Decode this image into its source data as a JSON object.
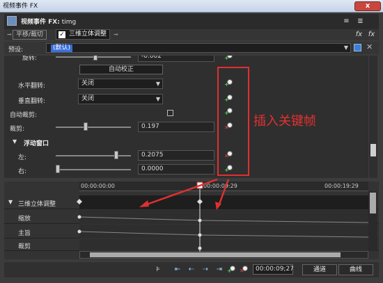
{
  "window": {
    "title": "视频事件 FX",
    "close_label": "x"
  },
  "header": {
    "title_bold": "视频事件 FX:",
    "title_rest": " timg",
    "btn_list": "≡",
    "btn_list2": "≣",
    "btn_fx1": "fx",
    "btn_fx2": "fx"
  },
  "tabs": [
    {
      "label": "平移/裁切"
    },
    {
      "label": "三维立体调整",
      "checked": true
    }
  ],
  "preset": {
    "label": "预设:",
    "value": "(默认)"
  },
  "params": {
    "rotation": {
      "label": "旋转:",
      "value": "-0.002"
    },
    "auto_correct": {
      "label": "自动校正"
    },
    "h_flip": {
      "label": "水平翻转:",
      "value": "关闭"
    },
    "v_flip": {
      "label": "垂直翻转:",
      "value": "关闭"
    },
    "auto_crop": {
      "label": "自动裁剪:"
    },
    "crop": {
      "label": "裁剪:",
      "value": "0.197",
      "fraction": 0.39
    },
    "floating_window": {
      "label": "浮动窗口"
    },
    "left": {
      "label": "左:",
      "value": "0.2075",
      "fraction": 0.82
    },
    "right": {
      "label": "右:",
      "value": "0.0000",
      "fraction": 0.0
    }
  },
  "annotation": "插入关键帧",
  "timeline": {
    "ruler": [
      "00:00:00:00",
      "00:00:09:29",
      "00:00:19:29"
    ],
    "tracks": [
      {
        "label": "三维立体调整"
      },
      {
        "label": "缩放"
      },
      {
        "label": "主旨"
      },
      {
        "label": "裁剪"
      }
    ]
  },
  "bottom": {
    "time": "00:00:09;27",
    "channel_label": "通道",
    "curve_label": "曲线",
    "tool_icons": [
      "keyframe-marker-icon",
      "first-keyframe-icon",
      "prev-keyframe-icon",
      "next-keyframe-icon",
      "last-keyframe-icon",
      "add-keyframe-icon",
      "delete-keyframe-icon"
    ]
  },
  "colors": {
    "accent_red": "#e03030",
    "plus_green": "#4cd24c",
    "selected_blue": "#3a6ed8"
  }
}
